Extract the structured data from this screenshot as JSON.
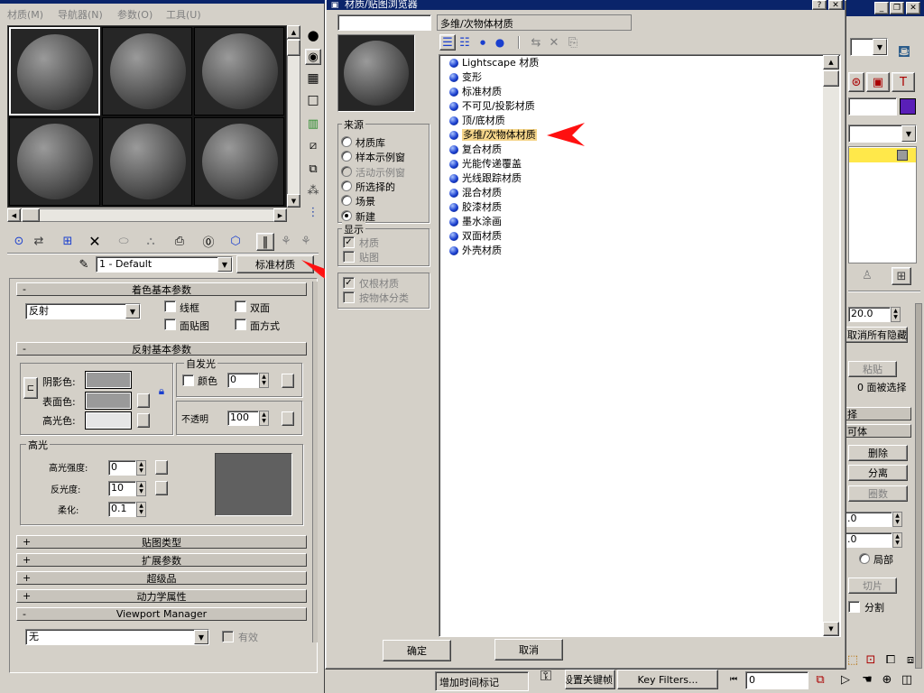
{
  "colors": {
    "title_blue": "#0a246a",
    "arrow_red": "#ff0000",
    "highlight_yellow": "#ffe84a",
    "selected_item_bg": "#f5d58a"
  },
  "material_editor": {
    "menu": [
      "材质(M)",
      "导航器(N)",
      "参数(O)",
      "工具(U)"
    ],
    "material_name": "1 - Default",
    "type_button": "标准材质",
    "rollouts": {
      "shader_basic": "着色基本参数",
      "shader_type": "反射",
      "wire": "线框",
      "two_sided": "双面",
      "face_map": "面贴图",
      "faceted": "面方式",
      "reflect_basic": "反射基本参数",
      "self_illum": "自发光",
      "color": "颜色",
      "self_illum_value": "0",
      "ambient": "阴影色:",
      "diffuse": "表面色:",
      "specular": "高光色:",
      "opacity": "不透明",
      "opacity_value": "100",
      "highlight": "高光",
      "spec_level": "高光强度:",
      "spec_level_value": "0",
      "glossiness": "反光度:",
      "glossiness_value": "10",
      "soften": "柔化:",
      "soften_value": "0.1",
      "maps": "贴图类型",
      "extended": "扩展参数",
      "supersampling": "超级品",
      "dynamics": "动力学属性",
      "viewport_manager": "Viewport Manager",
      "vm_none": "无",
      "vm_enable": "有效"
    },
    "swatch_colors": {
      "ambient": "#9a9a9a",
      "diffuse": "#9a9a9a",
      "specular": "#e6e6e6",
      "preview": "#606060"
    }
  },
  "browser": {
    "title": "材质/贴图浏览器",
    "search_value": "",
    "selected_name": "多维/次物体材质",
    "source_label": "来源",
    "source_options": [
      {
        "label": "材质库",
        "on": false,
        "disabled": false
      },
      {
        "label": "样本示例窗",
        "on": false,
        "disabled": false
      },
      {
        "label": "活动示例窗",
        "on": false,
        "disabled": true
      },
      {
        "label": "所选择的",
        "on": false,
        "disabled": false
      },
      {
        "label": "场景",
        "on": false,
        "disabled": false
      },
      {
        "label": "新建",
        "on": true,
        "disabled": false
      }
    ],
    "show_label": "显示",
    "show_options": [
      {
        "label": "材质",
        "checked": true
      },
      {
        "label": "贴图",
        "checked": false
      }
    ],
    "filter_options": [
      {
        "label": "仅根材质",
        "checked": true
      },
      {
        "label": "按物体分类",
        "checked": false
      }
    ],
    "items": [
      "Lightscape 材质",
      "变形",
      "标准材质",
      "不可见/投影材质",
      "顶/底材质",
      "多维/次物体材质",
      "复合材质",
      "光能传递覆盖",
      "光线跟踪材质",
      "混合材质",
      "胶漆材质",
      "墨水涂画",
      "双面材质",
      "外壳材质"
    ],
    "selected_index": 5,
    "ok": "确定",
    "cancel": "取消"
  },
  "right_panel": {
    "spin_value": "20.0",
    "unhide_all": "取消所有隐藏",
    "paste": "粘贴",
    "selected_faces": "0 面被选择",
    "select_label": "择",
    "visible_label": "可体",
    "delete": "删除",
    "detach": "分离",
    "collapse": "圈数",
    "val1": ".0",
    "val2": ".0",
    "local": "局部",
    "slice": "切片",
    "split": "分割"
  },
  "status": {
    "add_time_tag": "增加时间标记",
    "set_key": "设置关键帧",
    "key_filters": "Key Filters...",
    "frame": "0"
  }
}
